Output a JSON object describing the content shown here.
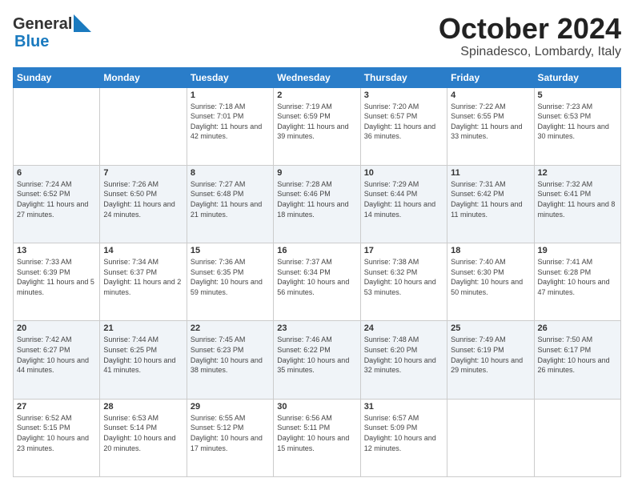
{
  "header": {
    "logo_general": "General",
    "logo_blue": "Blue",
    "month_title": "October 2024",
    "location": "Spinadesco, Lombardy, Italy"
  },
  "days_of_week": [
    "Sunday",
    "Monday",
    "Tuesday",
    "Wednesday",
    "Thursday",
    "Friday",
    "Saturday"
  ],
  "weeks": [
    [
      {
        "day": "",
        "content": ""
      },
      {
        "day": "",
        "content": ""
      },
      {
        "day": "1",
        "content": "Sunrise: 7:18 AM\nSunset: 7:01 PM\nDaylight: 11 hours and 42 minutes."
      },
      {
        "day": "2",
        "content": "Sunrise: 7:19 AM\nSunset: 6:59 PM\nDaylight: 11 hours and 39 minutes."
      },
      {
        "day": "3",
        "content": "Sunrise: 7:20 AM\nSunset: 6:57 PM\nDaylight: 11 hours and 36 minutes."
      },
      {
        "day": "4",
        "content": "Sunrise: 7:22 AM\nSunset: 6:55 PM\nDaylight: 11 hours and 33 minutes."
      },
      {
        "day": "5",
        "content": "Sunrise: 7:23 AM\nSunset: 6:53 PM\nDaylight: 11 hours and 30 minutes."
      }
    ],
    [
      {
        "day": "6",
        "content": "Sunrise: 7:24 AM\nSunset: 6:52 PM\nDaylight: 11 hours and 27 minutes."
      },
      {
        "day": "7",
        "content": "Sunrise: 7:26 AM\nSunset: 6:50 PM\nDaylight: 11 hours and 24 minutes."
      },
      {
        "day": "8",
        "content": "Sunrise: 7:27 AM\nSunset: 6:48 PM\nDaylight: 11 hours and 21 minutes."
      },
      {
        "day": "9",
        "content": "Sunrise: 7:28 AM\nSunset: 6:46 PM\nDaylight: 11 hours and 18 minutes."
      },
      {
        "day": "10",
        "content": "Sunrise: 7:29 AM\nSunset: 6:44 PM\nDaylight: 11 hours and 14 minutes."
      },
      {
        "day": "11",
        "content": "Sunrise: 7:31 AM\nSunset: 6:42 PM\nDaylight: 11 hours and 11 minutes."
      },
      {
        "day": "12",
        "content": "Sunrise: 7:32 AM\nSunset: 6:41 PM\nDaylight: 11 hours and 8 minutes."
      }
    ],
    [
      {
        "day": "13",
        "content": "Sunrise: 7:33 AM\nSunset: 6:39 PM\nDaylight: 11 hours and 5 minutes."
      },
      {
        "day": "14",
        "content": "Sunrise: 7:34 AM\nSunset: 6:37 PM\nDaylight: 11 hours and 2 minutes."
      },
      {
        "day": "15",
        "content": "Sunrise: 7:36 AM\nSunset: 6:35 PM\nDaylight: 10 hours and 59 minutes."
      },
      {
        "day": "16",
        "content": "Sunrise: 7:37 AM\nSunset: 6:34 PM\nDaylight: 10 hours and 56 minutes."
      },
      {
        "day": "17",
        "content": "Sunrise: 7:38 AM\nSunset: 6:32 PM\nDaylight: 10 hours and 53 minutes."
      },
      {
        "day": "18",
        "content": "Sunrise: 7:40 AM\nSunset: 6:30 PM\nDaylight: 10 hours and 50 minutes."
      },
      {
        "day": "19",
        "content": "Sunrise: 7:41 AM\nSunset: 6:28 PM\nDaylight: 10 hours and 47 minutes."
      }
    ],
    [
      {
        "day": "20",
        "content": "Sunrise: 7:42 AM\nSunset: 6:27 PM\nDaylight: 10 hours and 44 minutes."
      },
      {
        "day": "21",
        "content": "Sunrise: 7:44 AM\nSunset: 6:25 PM\nDaylight: 10 hours and 41 minutes."
      },
      {
        "day": "22",
        "content": "Sunrise: 7:45 AM\nSunset: 6:23 PM\nDaylight: 10 hours and 38 minutes."
      },
      {
        "day": "23",
        "content": "Sunrise: 7:46 AM\nSunset: 6:22 PM\nDaylight: 10 hours and 35 minutes."
      },
      {
        "day": "24",
        "content": "Sunrise: 7:48 AM\nSunset: 6:20 PM\nDaylight: 10 hours and 32 minutes."
      },
      {
        "day": "25",
        "content": "Sunrise: 7:49 AM\nSunset: 6:19 PM\nDaylight: 10 hours and 29 minutes."
      },
      {
        "day": "26",
        "content": "Sunrise: 7:50 AM\nSunset: 6:17 PM\nDaylight: 10 hours and 26 minutes."
      }
    ],
    [
      {
        "day": "27",
        "content": "Sunrise: 6:52 AM\nSunset: 5:15 PM\nDaylight: 10 hours and 23 minutes."
      },
      {
        "day": "28",
        "content": "Sunrise: 6:53 AM\nSunset: 5:14 PM\nDaylight: 10 hours and 20 minutes."
      },
      {
        "day": "29",
        "content": "Sunrise: 6:55 AM\nSunset: 5:12 PM\nDaylight: 10 hours and 17 minutes."
      },
      {
        "day": "30",
        "content": "Sunrise: 6:56 AM\nSunset: 5:11 PM\nDaylight: 10 hours and 15 minutes."
      },
      {
        "day": "31",
        "content": "Sunrise: 6:57 AM\nSunset: 5:09 PM\nDaylight: 10 hours and 12 minutes."
      },
      {
        "day": "",
        "content": ""
      },
      {
        "day": "",
        "content": ""
      }
    ]
  ]
}
